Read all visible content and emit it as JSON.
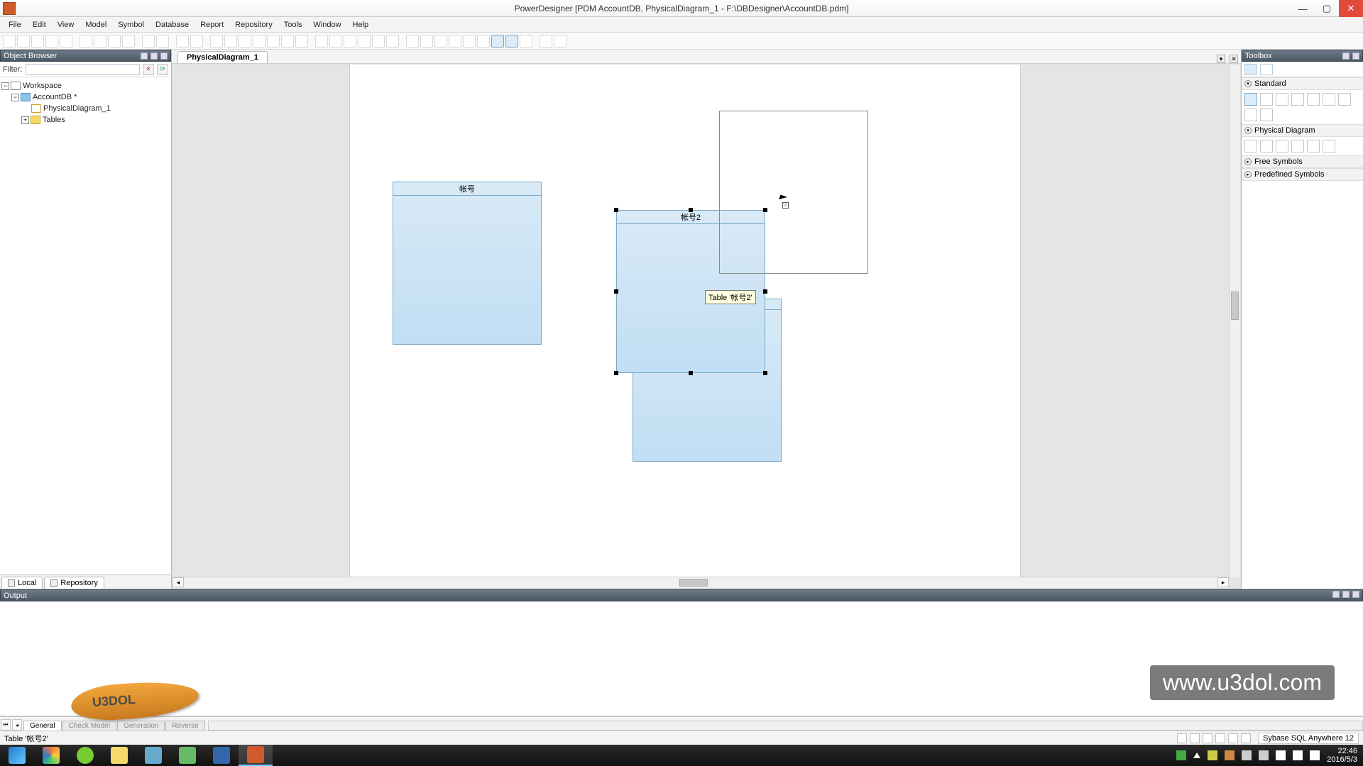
{
  "app": {
    "title": "PowerDesigner [PDM AccountDB, PhysicalDiagram_1 - F:\\DBDesigner\\AccountDB.pdm]"
  },
  "menu": [
    "File",
    "Edit",
    "View",
    "Model",
    "Symbol",
    "Database",
    "Report",
    "Repository",
    "Tools",
    "Window",
    "Help"
  ],
  "object_browser": {
    "title": "Object Browser",
    "filter_label": "Filter:",
    "filter_value": "",
    "tree": {
      "workspace": "Workspace",
      "model": "AccountDB *",
      "diagram": "PhysicalDiagram_1",
      "tables_folder": "Tables"
    },
    "tabs": {
      "local": "Local",
      "repository": "Repository"
    }
  },
  "document_tab": "PhysicalDiagram_1",
  "entities": {
    "e1": "帐号",
    "e2": "帐号2",
    "tooltip": "Table '帐号2'"
  },
  "toolbox": {
    "title": "Toolbox",
    "sections": {
      "standard": "Standard",
      "physical": "Physical Diagram",
      "free": "Free Symbols",
      "predefined": "Predefined Symbols"
    }
  },
  "output": {
    "title": "Output",
    "tabs": [
      "General",
      "Check Model",
      "Generation",
      "Reverse"
    ],
    "watermark": "www.u3dol.com",
    "logo": "U3DOL"
  },
  "status": {
    "left": "Table '帐号2'",
    "dbms": "Sybase SQL Anywhere 12"
  },
  "tray": {
    "time": "22:46",
    "date": "2016/5/3"
  }
}
